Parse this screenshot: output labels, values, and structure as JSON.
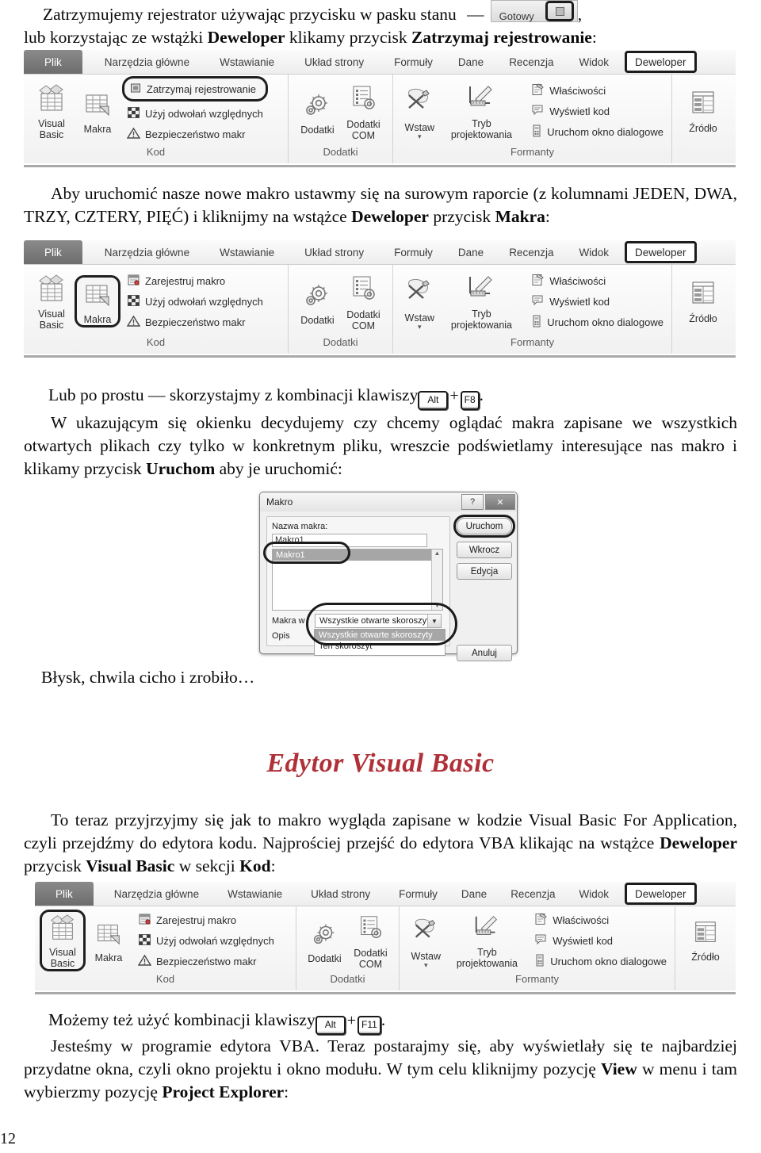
{
  "page": {
    "number": "12"
  },
  "intro": {
    "line1_a": "Zatrzymujemy rejestrator używając przycisku w pasku stanu",
    "dash": "—",
    "status_chip": {
      "label": "Gotowy",
      "button_name": "stop-recording-button"
    },
    "comma": ",",
    "line2_a": "lub korzystając ze wstążki ",
    "line2_bold1": "Deweloper",
    "line2_b": " klikamy przycisk ",
    "line2_bold2": "Zatrzymaj rejestrowanie",
    "line2_c": ":"
  },
  "ribbon_tabs": [
    "Plik",
    "Narzędzia główne",
    "Wstawianie",
    "Układ strony",
    "Formuły",
    "Dane",
    "Recenzja",
    "Widok",
    "Deweloper"
  ],
  "ribbon1": {
    "group_kod": {
      "title": "Kod",
      "big_buttons": [
        {
          "label_line1": "Visual",
          "label_line2": "Basic",
          "icon": "visual-basic-icon",
          "highlighted": false
        },
        {
          "label_line1": "Makra",
          "label_line2": "",
          "icon": "macros-icon",
          "highlighted": false
        }
      ],
      "small_buttons": [
        {
          "label": "Zatrzymaj rejestrowanie",
          "icon": "stop-square-icon",
          "highlighted": true
        },
        {
          "label": "Użyj odwołań względnych",
          "icon": "relative-refs-icon",
          "highlighted": false
        },
        {
          "label": "Bezpieczeństwo makr",
          "icon": "warning-triangle-icon",
          "highlighted": false
        }
      ]
    },
    "group_dodatki": {
      "title": "Dodatki",
      "buttons": [
        {
          "label_line1": "Dodatki",
          "label_line2": "",
          "icon": "gear-icon"
        },
        {
          "label_line1": "Dodatki",
          "label_line2": "COM",
          "icon": "gear-list-icon"
        }
      ]
    },
    "group_formanty": {
      "title": "Formanty",
      "big_buttons": [
        {
          "label_line1": "Wstaw",
          "label_line2": "",
          "icon": "insert-controls-icon",
          "has_arrow": true
        },
        {
          "label_line1": "Tryb",
          "label_line2": "projektowania",
          "icon": "design-mode-icon",
          "has_arrow": false
        }
      ],
      "small_buttons": [
        {
          "label": "Właściwości",
          "icon": "properties-icon"
        },
        {
          "label": "Wyświetl kod",
          "icon": "view-code-icon"
        },
        {
          "label": "Uruchom okno dialogowe",
          "icon": "run-dialog-icon"
        }
      ]
    },
    "group_xml": {
      "title": "",
      "buttons": [
        {
          "label_line1": "Źródło",
          "label_line2": "",
          "icon": "xml-source-icon"
        }
      ]
    }
  },
  "para2": {
    "a": "Aby uruchomić nasze nowe makro ustawmy się na surowym raporcie (z kolumnami JEDEN, DWA, TRZY, CZTERY, PIĘĆ) i kliknijmy na wstążce ",
    "bold1": "Deweloper",
    "b": " przycisk ",
    "bold2": "Makra",
    "c": ":"
  },
  "ribbon2": {
    "group_kod": {
      "title": "Kod",
      "big_buttons": [
        {
          "label_line1": "Visual",
          "label_line2": "Basic",
          "icon": "visual-basic-icon",
          "highlighted": false
        },
        {
          "label_line1": "Makra",
          "label_line2": "",
          "icon": "macros-icon",
          "highlighted": true
        }
      ],
      "small_buttons": [
        {
          "label": "Zarejestruj makro",
          "icon": "record-macro-icon",
          "highlighted": false
        },
        {
          "label": "Użyj odwołań względnych",
          "icon": "relative-refs-icon",
          "highlighted": false
        },
        {
          "label": "Bezpieczeństwo makr",
          "icon": "warning-triangle-icon",
          "highlighted": false
        }
      ]
    }
  },
  "para3": {
    "line1_a": "Lub po prostu — skorzystajmy z kombinacji klawiszy ",
    "key1": "Alt",
    "plus": "+",
    "key2": "F8",
    "line1_b": ".",
    "body_a": "W ukazującym się okienku decydujemy czy chcemy oglądać makra zapisane we wszystkich otwartych plikach czy tylko w konkretnym pliku, wreszcie podświetlamy interesujące nas makro i klikamy przycisk ",
    "body_bold": "Uruchom",
    "body_b": " aby je uruchomić:"
  },
  "makro_dialog": {
    "title": "Makro",
    "titlebar_help": "?",
    "titlebar_close": "✕",
    "name_label": "Nazwa makra:",
    "name_value": "Makro1",
    "list_items": [
      "Makro1"
    ],
    "macros_in_label": "Makra w",
    "description_label": "Opis",
    "combo_value": "Wszystkie otwarte skoroszyty",
    "combo_options": [
      "Wszystkie otwarte skoroszyty",
      "Ten skoroszyt"
    ],
    "buttons": [
      "Uruchom",
      "Wkrocz",
      "Edycja",
      "Anuluj"
    ],
    "highlighted_button": "Uruchom"
  },
  "para4": {
    "text": "Błysk, chwila cicho i zrobiło…"
  },
  "heading": {
    "text": "Edytor Visual Basic",
    "color": "#b03038"
  },
  "para5": {
    "a": "To teraz przyjrzyjmy się jak to makro wygląda zapisane w kodzie Visual Basic For Application, czyli przejdźmy do edytora kodu. Najprościej przejść do edytora VBA klikając na wstążce ",
    "bold1": "Deweloper",
    "b": " przycisk ",
    "bold2": "Visual Basic",
    "c": " w sekcji ",
    "bold3": "Kod",
    "d": ":"
  },
  "ribbon3": {
    "group_kod": {
      "title": "Kod",
      "big_buttons": [
        {
          "label_line1": "Visual",
          "label_line2": "Basic",
          "icon": "visual-basic-icon",
          "highlighted": true
        },
        {
          "label_line1": "Makra",
          "label_line2": "",
          "icon": "macros-icon",
          "highlighted": false
        }
      ],
      "small_buttons": [
        {
          "label": "Zarejestruj makro",
          "icon": "record-macro-icon",
          "highlighted": false
        },
        {
          "label": "Użyj odwołań względnych",
          "icon": "relative-refs-icon",
          "highlighted": false
        },
        {
          "label": "Bezpieczeństwo makr",
          "icon": "warning-triangle-icon",
          "highlighted": false
        }
      ]
    }
  },
  "para6": {
    "line1_a": "Możemy też użyć kombinacji klawiszy ",
    "key1": "Alt",
    "plus": "+",
    "key2": "F11",
    "line1_b": ".",
    "body_a": "Jesteśmy w programie edytora VBA. Teraz postarajmy się, aby wyświetlały się te najbardziej przydatne okna, czyli okno projektu i okno modułu. W tym celu kliknijmy pozycję ",
    "body_bold1": "View",
    "body_b": " w menu i tam wybierzmy pozycję ",
    "body_bold2": "Project Explorer",
    "body_c": ":"
  }
}
